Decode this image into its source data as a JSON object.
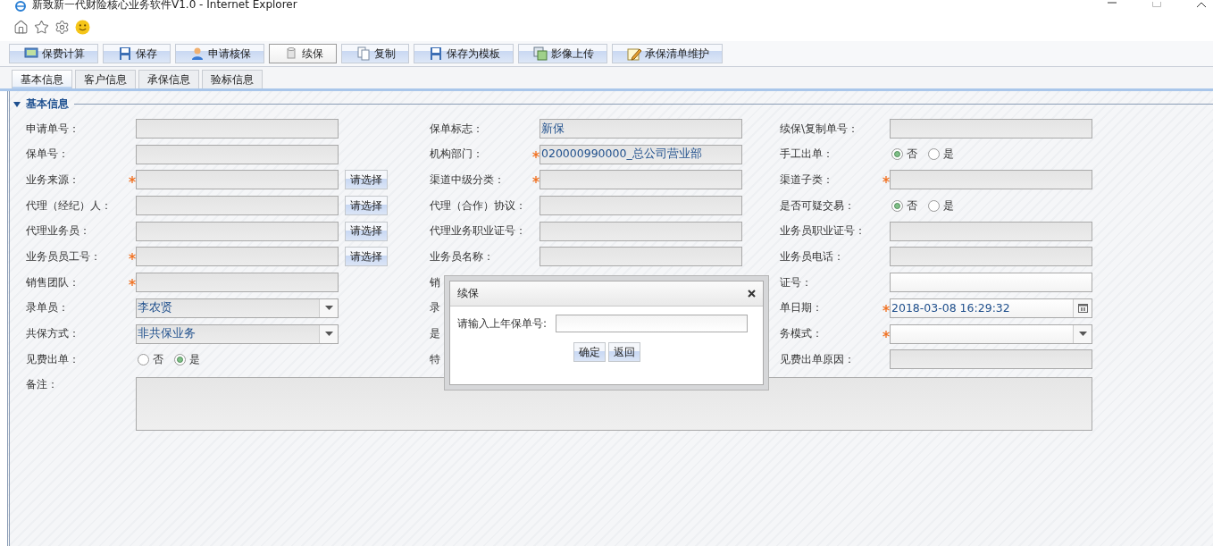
{
  "window": {
    "title": "新致新一代财险核心业务软件V1.0 - Internet Explorer"
  },
  "toolbar": [
    {
      "label": "保费计算",
      "pressed": false
    },
    {
      "label": "保存",
      "pressed": false
    },
    {
      "label": "申请核保",
      "pressed": false
    },
    {
      "label": "续保",
      "pressed": true
    },
    {
      "label": "复制",
      "pressed": false
    },
    {
      "label": "保存为模板",
      "pressed": false
    },
    {
      "label": "影像上传",
      "pressed": false
    },
    {
      "label": "承保清单维护",
      "pressed": false
    }
  ],
  "tabs": [
    {
      "label": "基本信息",
      "selected": true
    },
    {
      "label": "客户信息",
      "selected": false
    },
    {
      "label": "承保信息",
      "selected": false
    },
    {
      "label": "验标信息",
      "selected": false
    }
  ],
  "section": {
    "title": "基本信息",
    "expanded": true
  },
  "form_rows": [
    [
      {
        "kind": "text",
        "label": "申请单号：",
        "required": false,
        "disabled": true
      },
      {
        "kind": "text",
        "label": "保单标志：",
        "required": false,
        "disabled": true,
        "value": "新保"
      },
      {
        "kind": "text",
        "label": "续保\\复制单号：",
        "required": false,
        "disabled": true
      }
    ],
    [
      {
        "kind": "text",
        "label": "保单号：",
        "required": false,
        "disabled": true
      },
      {
        "kind": "text",
        "label": "机构部门：",
        "required": true,
        "disabled": true,
        "value": "020000990000_总公司营业部"
      },
      {
        "kind": "radio",
        "label": "手工出单：",
        "options": [
          {
            "label": "否",
            "selected": true
          },
          {
            "label": "是",
            "selected": false
          }
        ]
      }
    ],
    [
      {
        "kind": "text",
        "label": "业务来源：",
        "required": true,
        "disabled": true,
        "button": "请选择"
      },
      {
        "kind": "text",
        "label": "渠道中级分类：",
        "required": true,
        "disabled": true
      },
      {
        "kind": "text",
        "label": "渠道子类：",
        "required": true,
        "disabled": true
      }
    ],
    [
      {
        "kind": "text",
        "label": "代理（经纪）人：",
        "required": false,
        "disabled": true,
        "button": "请选择"
      },
      {
        "kind": "text",
        "label": "代理（合作）协议：",
        "required": false,
        "disabled": true
      },
      {
        "kind": "radio",
        "label": "是否可疑交易：",
        "options": [
          {
            "label": "否",
            "selected": true
          },
          {
            "label": "是",
            "selected": false
          }
        ]
      }
    ],
    [
      {
        "kind": "text",
        "label": "代理业务员：",
        "required": false,
        "disabled": true,
        "button": "请选择"
      },
      {
        "kind": "text",
        "label": "代理业务职业证号：",
        "required": false,
        "disabled": true
      },
      {
        "kind": "text",
        "label": "业务员职业证号：",
        "required": false,
        "disabled": true
      }
    ],
    [
      {
        "kind": "text",
        "label": "业务员员工号：",
        "required": true,
        "disabled": true,
        "button": "请选择"
      },
      {
        "kind": "text",
        "label": "业务员名称：",
        "required": false,
        "disabled": true
      },
      {
        "kind": "text",
        "label": "业务员电话：",
        "required": false,
        "disabled": true
      }
    ],
    [
      {
        "kind": "text",
        "label": "销售团队：",
        "required": true,
        "disabled": true
      },
      {
        "kind": "label",
        "label": "销"
      },
      {
        "kind": "text",
        "label": "证号：",
        "required": false,
        "disabled": false
      }
    ],
    [
      {
        "kind": "select",
        "label": "录单员：",
        "required": false,
        "disabled": true,
        "value": "李农贤"
      },
      {
        "kind": "label",
        "label": "录"
      },
      {
        "kind": "date",
        "label": "单日期：",
        "required": true,
        "disabled": false,
        "value": "2018-03-08 16:29:32"
      }
    ],
    [
      {
        "kind": "select",
        "label": "共保方式：",
        "required": false,
        "disabled": true,
        "value": "非共保业务"
      },
      {
        "kind": "label",
        "label": "是"
      },
      {
        "kind": "select",
        "label": "务模式：",
        "required": true,
        "disabled": false
      }
    ],
    [
      {
        "kind": "radio",
        "label": "见费出单：",
        "options": [
          {
            "label": "否",
            "selected": false
          },
          {
            "label": "是",
            "selected": true
          }
        ]
      },
      {
        "kind": "label",
        "label": "特"
      },
      {
        "kind": "text",
        "label": "见费出单原因：",
        "required": false,
        "disabled": true
      }
    ]
  ],
  "remarks": {
    "label": "备注：",
    "disabled": true
  },
  "dialog": {
    "title": "续保",
    "prompt": "请输入上年保单号:",
    "buttons": [
      "确定",
      "返回"
    ]
  }
}
